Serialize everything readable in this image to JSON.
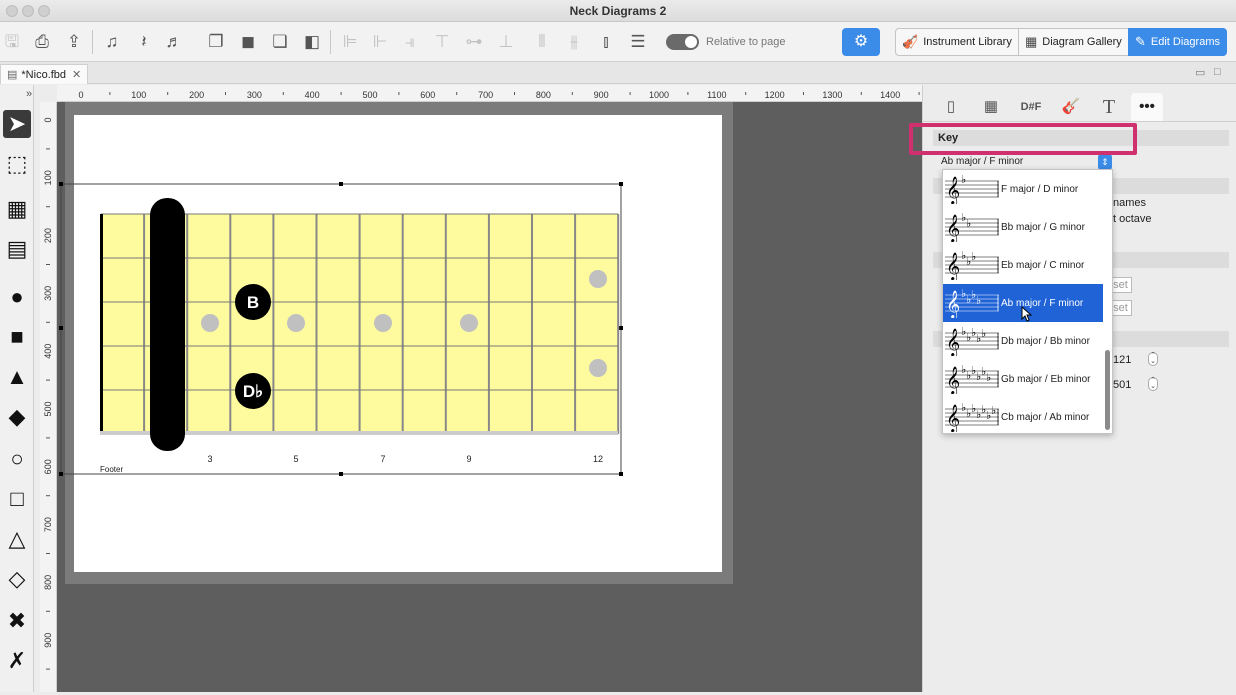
{
  "window": {
    "title": "Neck Diagrams 2"
  },
  "toolbar": {
    "relative_label": "Relative to page",
    "instrument_library": "Instrument Library",
    "diagram_gallery": "Diagram Gallery",
    "edit_diagrams": "Edit Diagrams",
    "accent_color": "#3b8be8"
  },
  "file_tab": {
    "name": "*Nico.fbd"
  },
  "rulers": {
    "horizontal": [
      "0",
      "100",
      "200",
      "300",
      "400",
      "500",
      "600",
      "700",
      "800",
      "900",
      "1000",
      "1100",
      "1200",
      "1300",
      "1400"
    ],
    "vertical": [
      "0",
      "100",
      "200",
      "300",
      "400",
      "500",
      "600",
      "700",
      "800",
      "900"
    ]
  },
  "diagram": {
    "fret_colors": {
      "fretboard": "#fdfb9d",
      "markers": "#c0c0c0",
      "notes": "#000000"
    },
    "notes": [
      "B",
      "D♭"
    ],
    "fret_numbers": [
      "3",
      "5",
      "7",
      "9",
      "12"
    ],
    "footer": "Footer"
  },
  "panel": {
    "tabs": [
      "string-icon",
      "grid-icon",
      "D#F",
      "guitar-icon",
      "text-icon",
      "more-icon"
    ],
    "tab_labels": {
      "notes": "D#F",
      "more": "•••"
    },
    "key_header": "Key",
    "key_value": "Ab major / F minor",
    "partial_texts": [
      "names",
      "t octave",
      "eset",
      "eset",
      "121",
      "501"
    ],
    "highlight_color": "#d0306e"
  },
  "key_dropdown": {
    "options": [
      {
        "label": "F major / D minor",
        "flats": 1
      },
      {
        "label": "Bb major / G minor",
        "flats": 2
      },
      {
        "label": "Eb major / C minor",
        "flats": 3
      },
      {
        "label": "Ab major / F minor",
        "flats": 4,
        "selected": true
      },
      {
        "label": "Db major / Bb minor",
        "flats": 5
      },
      {
        "label": "Gb major / Eb minor",
        "flats": 6
      },
      {
        "label": "Cb major / Ab minor",
        "flats": 7
      }
    ]
  }
}
